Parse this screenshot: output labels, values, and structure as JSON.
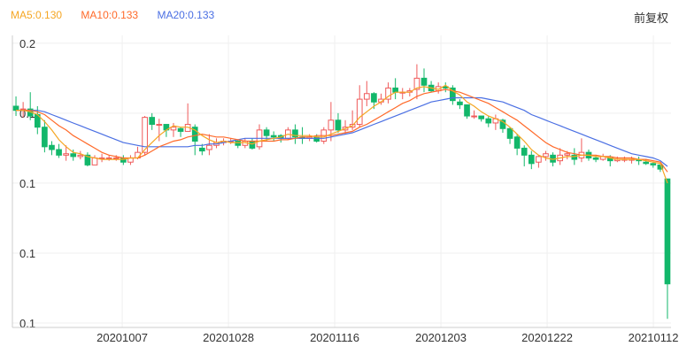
{
  "legend": {
    "ma5": {
      "label": "MA5:0.130",
      "color": "#f5a623"
    },
    "ma10": {
      "label": "MA10:0.133",
      "color": "#ff6a2a"
    },
    "ma20": {
      "label": "MA20:0.133",
      "color": "#4a6fe3"
    }
  },
  "mode_label": "前复权",
  "colors": {
    "up": "#ef5a5a",
    "down": "#12b76a",
    "grid": "#efefef",
    "axis": "#cccccc"
  },
  "chart_data": {
    "type": "candlestick",
    "ylim": [
      0.0,
      0.2
    ],
    "y_ticks": [
      {
        "value": 0.2,
        "label": "0.2"
      },
      {
        "value": 0.15,
        "label": "0.1"
      },
      {
        "value": 0.1,
        "label": "0.1"
      },
      {
        "value": 0.05,
        "label": "0.1"
      },
      {
        "value": 0.0,
        "label": "0.1"
      }
    ],
    "x_ticks": [
      {
        "index": 10,
        "label": "20201007"
      },
      {
        "index": 20,
        "label": "20201028"
      },
      {
        "index": 30,
        "label": "20201116"
      },
      {
        "index": 40,
        "label": "20201203"
      },
      {
        "index": 50,
        "label": "20201222"
      },
      {
        "index": 60,
        "label": "20210112"
      }
    ],
    "candles": [
      [
        0.155,
        0.152,
        0.162,
        0.148
      ],
      [
        0.153,
        0.153,
        0.158,
        0.147
      ],
      [
        0.153,
        0.148,
        0.165,
        0.145
      ],
      [
        0.149,
        0.14,
        0.155,
        0.135
      ],
      [
        0.14,
        0.126,
        0.145,
        0.122
      ],
      [
        0.127,
        0.124,
        0.13,
        0.12
      ],
      [
        0.124,
        0.12,
        0.128,
        0.118
      ],
      [
        0.12,
        0.121,
        0.127,
        0.116
      ],
      [
        0.121,
        0.119,
        0.124,
        0.116
      ],
      [
        0.119,
        0.12,
        0.123,
        0.117
      ],
      [
        0.12,
        0.113,
        0.122,
        0.112
      ],
      [
        0.113,
        0.118,
        0.12,
        0.113
      ],
      [
        0.118,
        0.118,
        0.121,
        0.115
      ],
      [
        0.118,
        0.118,
        0.12,
        0.116
      ],
      [
        0.118,
        0.118,
        0.12,
        0.116
      ],
      [
        0.118,
        0.115,
        0.12,
        0.113
      ],
      [
        0.115,
        0.118,
        0.12,
        0.113
      ],
      [
        0.118,
        0.122,
        0.126,
        0.117
      ],
      [
        0.122,
        0.147,
        0.148,
        0.12
      ],
      [
        0.147,
        0.142,
        0.15,
        0.138
      ],
      [
        0.142,
        0.142,
        0.146,
        0.13
      ],
      [
        0.142,
        0.138,
        0.14,
        0.133
      ],
      [
        0.138,
        0.14,
        0.143,
        0.133
      ],
      [
        0.139,
        0.137,
        0.14,
        0.133
      ],
      [
        0.137,
        0.142,
        0.157,
        0.137
      ],
      [
        0.14,
        0.13,
        0.142,
        0.12
      ],
      [
        0.125,
        0.123,
        0.128,
        0.12
      ],
      [
        0.124,
        0.127,
        0.135,
        0.12
      ],
      [
        0.127,
        0.129,
        0.132,
        0.125
      ],
      [
        0.129,
        0.13,
        0.132,
        0.127
      ],
      [
        0.13,
        0.13,
        0.132,
        0.128
      ],
      [
        0.13,
        0.127,
        0.131,
        0.125
      ],
      [
        0.127,
        0.13,
        0.132,
        0.125
      ],
      [
        0.13,
        0.125,
        0.132,
        0.124
      ],
      [
        0.126,
        0.138,
        0.142,
        0.124
      ],
      [
        0.138,
        0.134,
        0.14,
        0.13
      ],
      [
        0.134,
        0.133,
        0.137,
        0.13
      ],
      [
        0.134,
        0.132,
        0.135,
        0.129
      ],
      [
        0.132,
        0.138,
        0.14,
        0.131
      ],
      [
        0.138,
        0.133,
        0.142,
        0.128
      ],
      [
        0.133,
        0.132,
        0.14,
        0.128
      ],
      [
        0.132,
        0.133,
        0.135,
        0.13
      ],
      [
        0.133,
        0.13,
        0.135,
        0.129
      ],
      [
        0.13,
        0.138,
        0.14,
        0.128
      ],
      [
        0.138,
        0.145,
        0.158,
        0.13
      ],
      [
        0.145,
        0.138,
        0.15,
        0.136
      ],
      [
        0.138,
        0.14,
        0.145,
        0.135
      ],
      [
        0.14,
        0.142,
        0.152,
        0.138
      ],
      [
        0.142,
        0.16,
        0.17,
        0.14
      ],
      [
        0.16,
        0.164,
        0.173,
        0.155
      ],
      [
        0.164,
        0.158,
        0.165,
        0.153
      ],
      [
        0.158,
        0.16,
        0.164,
        0.156
      ],
      [
        0.16,
        0.168,
        0.172,
        0.157
      ],
      [
        0.168,
        0.165,
        0.175,
        0.16
      ],
      [
        0.165,
        0.165,
        0.168,
        0.16
      ],
      [
        0.165,
        0.166,
        0.168,
        0.162
      ],
      [
        0.167,
        0.175,
        0.185,
        0.16
      ],
      [
        0.175,
        0.17,
        0.182,
        0.165
      ],
      [
        0.17,
        0.166,
        0.173,
        0.165
      ],
      [
        0.166,
        0.169,
        0.172,
        0.164
      ],
      [
        0.169,
        0.168,
        0.172,
        0.165
      ],
      [
        0.168,
        0.159,
        0.17,
        0.156
      ],
      [
        0.158,
        0.156,
        0.16,
        0.153
      ],
      [
        0.156,
        0.148,
        0.156,
        0.146
      ],
      [
        0.148,
        0.148,
        0.152,
        0.146
      ],
      [
        0.148,
        0.146,
        0.148,
        0.144
      ],
      [
        0.146,
        0.143,
        0.148,
        0.14
      ],
      [
        0.143,
        0.146,
        0.149,
        0.138
      ],
      [
        0.145,
        0.139,
        0.146,
        0.136
      ],
      [
        0.139,
        0.132,
        0.14,
        0.128
      ],
      [
        0.133,
        0.125,
        0.135,
        0.12
      ],
      [
        0.125,
        0.12,
        0.127,
        0.112
      ],
      [
        0.12,
        0.114,
        0.123,
        0.11
      ],
      [
        0.115,
        0.119,
        0.12,
        0.111
      ],
      [
        0.119,
        0.121,
        0.123,
        0.116
      ],
      [
        0.12,
        0.115,
        0.122,
        0.112
      ],
      [
        0.116,
        0.12,
        0.125,
        0.113
      ],
      [
        0.12,
        0.121,
        0.123,
        0.117
      ],
      [
        0.12,
        0.117,
        0.125,
        0.113
      ],
      [
        0.118,
        0.122,
        0.132,
        0.115
      ],
      [
        0.122,
        0.118,
        0.124,
        0.116
      ],
      [
        0.118,
        0.117,
        0.12,
        0.115
      ],
      [
        0.117,
        0.119,
        0.121,
        0.116
      ],
      [
        0.118,
        0.116,
        0.12,
        0.112
      ],
      [
        0.116,
        0.117,
        0.119,
        0.115
      ],
      [
        0.117,
        0.117,
        0.119,
        0.115
      ],
      [
        0.117,
        0.117,
        0.119,
        0.114
      ],
      [
        0.117,
        0.116,
        0.119,
        0.113
      ],
      [
        0.115,
        0.114,
        0.117,
        0.113
      ],
      [
        0.114,
        0.113,
        0.115,
        0.111
      ],
      [
        0.113,
        0.11,
        0.113,
        0.108
      ],
      [
        0.103,
        0.028,
        0.103,
        0.003
      ]
    ],
    "ma5": [
      0.152,
      0.152,
      0.151,
      0.149,
      0.144,
      0.138,
      0.131,
      0.126,
      0.122,
      0.121,
      0.119,
      0.118,
      0.117,
      0.117,
      0.117,
      0.117,
      0.118,
      0.118,
      0.124,
      0.129,
      0.134,
      0.138,
      0.141,
      0.14,
      0.14,
      0.138,
      0.134,
      0.131,
      0.129,
      0.13,
      0.129,
      0.129,
      0.129,
      0.128,
      0.13,
      0.131,
      0.132,
      0.133,
      0.135,
      0.134,
      0.134,
      0.134,
      0.133,
      0.133,
      0.135,
      0.137,
      0.139,
      0.141,
      0.147,
      0.151,
      0.155,
      0.158,
      0.162,
      0.165,
      0.165,
      0.165,
      0.168,
      0.169,
      0.168,
      0.167,
      0.17,
      0.166,
      0.163,
      0.158,
      0.155,
      0.151,
      0.148,
      0.146,
      0.144,
      0.14,
      0.135,
      0.13,
      0.124,
      0.12,
      0.118,
      0.117,
      0.118,
      0.119,
      0.119,
      0.12,
      0.12,
      0.119,
      0.119,
      0.118,
      0.117,
      0.117,
      0.117,
      0.117,
      0.116,
      0.115,
      0.114,
      0.1
    ],
    "ma10": [
      0.152,
      0.152,
      0.152,
      0.151,
      0.149,
      0.145,
      0.141,
      0.138,
      0.134,
      0.131,
      0.128,
      0.125,
      0.122,
      0.12,
      0.119,
      0.118,
      0.118,
      0.118,
      0.12,
      0.123,
      0.126,
      0.128,
      0.13,
      0.131,
      0.133,
      0.134,
      0.135,
      0.134,
      0.133,
      0.133,
      0.132,
      0.131,
      0.13,
      0.13,
      0.13,
      0.13,
      0.13,
      0.131,
      0.131,
      0.132,
      0.133,
      0.133,
      0.134,
      0.134,
      0.134,
      0.135,
      0.136,
      0.137,
      0.14,
      0.142,
      0.145,
      0.148,
      0.151,
      0.154,
      0.157,
      0.159,
      0.162,
      0.164,
      0.165,
      0.166,
      0.167,
      0.166,
      0.165,
      0.163,
      0.161,
      0.159,
      0.157,
      0.154,
      0.151,
      0.148,
      0.145,
      0.141,
      0.137,
      0.133,
      0.129,
      0.126,
      0.124,
      0.122,
      0.121,
      0.12,
      0.12,
      0.12,
      0.119,
      0.119,
      0.118,
      0.118,
      0.118,
      0.117,
      0.117,
      0.116,
      0.115,
      0.108
    ],
    "ma20": [
      0.152,
      0.152,
      0.152,
      0.152,
      0.151,
      0.149,
      0.147,
      0.145,
      0.143,
      0.141,
      0.139,
      0.137,
      0.135,
      0.133,
      0.131,
      0.129,
      0.128,
      0.127,
      0.126,
      0.126,
      0.126,
      0.126,
      0.126,
      0.126,
      0.126,
      0.127,
      0.127,
      0.128,
      0.128,
      0.129,
      0.13,
      0.131,
      0.132,
      0.132,
      0.132,
      0.132,
      0.132,
      0.132,
      0.132,
      0.132,
      0.132,
      0.132,
      0.132,
      0.132,
      0.133,
      0.134,
      0.135,
      0.136,
      0.138,
      0.14,
      0.142,
      0.144,
      0.146,
      0.148,
      0.15,
      0.152,
      0.154,
      0.156,
      0.158,
      0.159,
      0.16,
      0.161,
      0.161,
      0.161,
      0.161,
      0.161,
      0.16,
      0.159,
      0.158,
      0.156,
      0.154,
      0.152,
      0.149,
      0.147,
      0.145,
      0.143,
      0.141,
      0.139,
      0.137,
      0.135,
      0.133,
      0.131,
      0.129,
      0.127,
      0.125,
      0.123,
      0.121,
      0.12,
      0.119,
      0.118,
      0.116,
      0.112
    ]
  }
}
